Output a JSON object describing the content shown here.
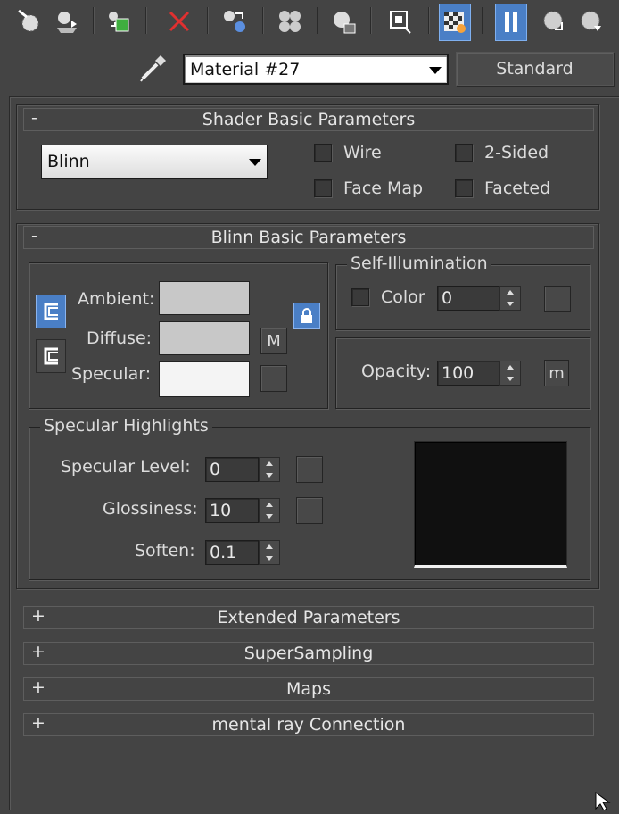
{
  "material": {
    "name": "Material #27",
    "type_button": "Standard"
  },
  "colors": {
    "background": "#444444",
    "active_blue": "#4a7fc6",
    "ambient_swatch": "#c8c8c8",
    "diffuse_swatch": "#c8c8c8",
    "specular_swatch": "#f4f4f4",
    "preview": "#101010"
  },
  "shader_basic": {
    "header": "Shader Basic Parameters",
    "toggle": "-",
    "shader": "Blinn",
    "wire": "Wire",
    "two_sided": "2-Sided",
    "face_map": "Face Map",
    "faceted": "Faceted"
  },
  "blinn_basic": {
    "header": "Blinn Basic Parameters",
    "toggle": "-",
    "ambient": "Ambient:",
    "diffuse": "Diffuse:",
    "specular": "Specular:",
    "diffuse_map": "M",
    "self_illum_title": "Self-Illumination",
    "color": "Color",
    "self_illum_value": "0",
    "opacity": "Opacity:",
    "opacity_value": "100",
    "opacity_map": "m"
  },
  "specular_highlights": {
    "title": "Specular Highlights",
    "level_label": "Specular Level:",
    "level_value": "0",
    "glossiness_label": "Glossiness:",
    "glossiness_value": "10",
    "soften_label": "Soften:",
    "soften_value": "0.1"
  },
  "rollouts": [
    {
      "sign": "+",
      "label": "Extended Parameters"
    },
    {
      "sign": "+",
      "label": "SuperSampling"
    },
    {
      "sign": "+",
      "label": "Maps"
    },
    {
      "sign": "+",
      "label": "mental ray Connection"
    }
  ]
}
